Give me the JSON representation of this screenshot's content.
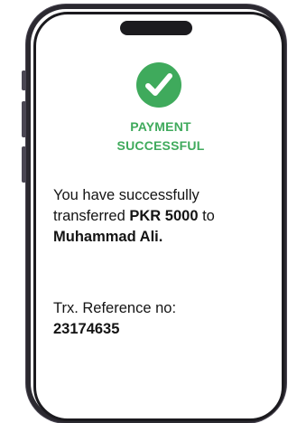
{
  "status": {
    "line1": "PAYMENT",
    "line2": "SUCCESSFUL",
    "icon": "check-circle-icon",
    "color": "#3faa5c"
  },
  "message": {
    "part1": "You have successfully transferred ",
    "amount": "PKR 5000",
    "part2": " to ",
    "recipient": "Muhammad Ali."
  },
  "reference": {
    "label": "Trx. Reference no:",
    "number": "23174635"
  }
}
